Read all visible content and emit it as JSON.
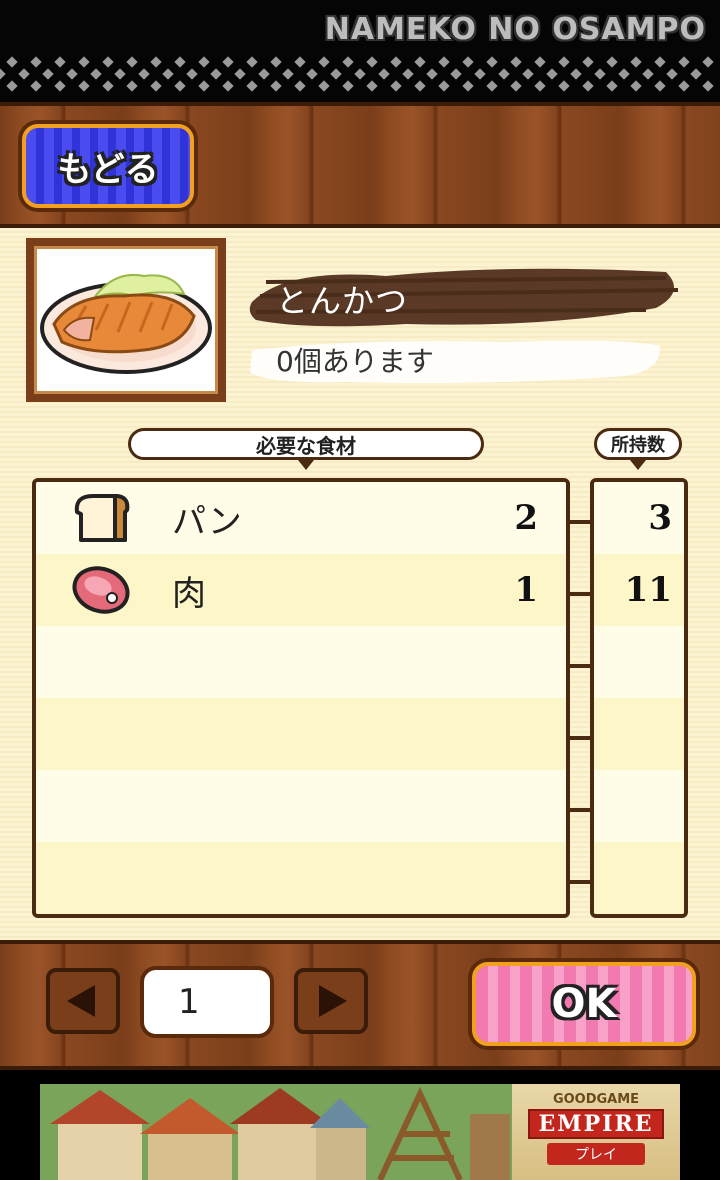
{
  "app": {
    "title": "NAMEKO NO OSAMPO"
  },
  "header": {
    "back_label": "もどる"
  },
  "dish": {
    "name": "とんかつ",
    "count_text": "0個あります",
    "image_icon": "tonkatsu-plate"
  },
  "table": {
    "required_header": "必要な食材",
    "owned_header": "所持数",
    "rows": [
      {
        "icon": "bread-icon",
        "name": "パン",
        "required": "2",
        "owned": "3"
      },
      {
        "icon": "meat-icon",
        "name": "肉",
        "required": "1",
        "owned": "11"
      }
    ]
  },
  "pager": {
    "page": "1"
  },
  "ok_label": "OK",
  "ad": {
    "brand_top": "GOODGAME",
    "brand_main": "EMPIRE",
    "cta": "プレイ"
  },
  "colors": {
    "wood": "#8e4b22",
    "cream": "#fbf3d2",
    "back_button": "#3f42e8",
    "ok_button": "#f27ab0",
    "border_dark": "#4a2a10"
  }
}
